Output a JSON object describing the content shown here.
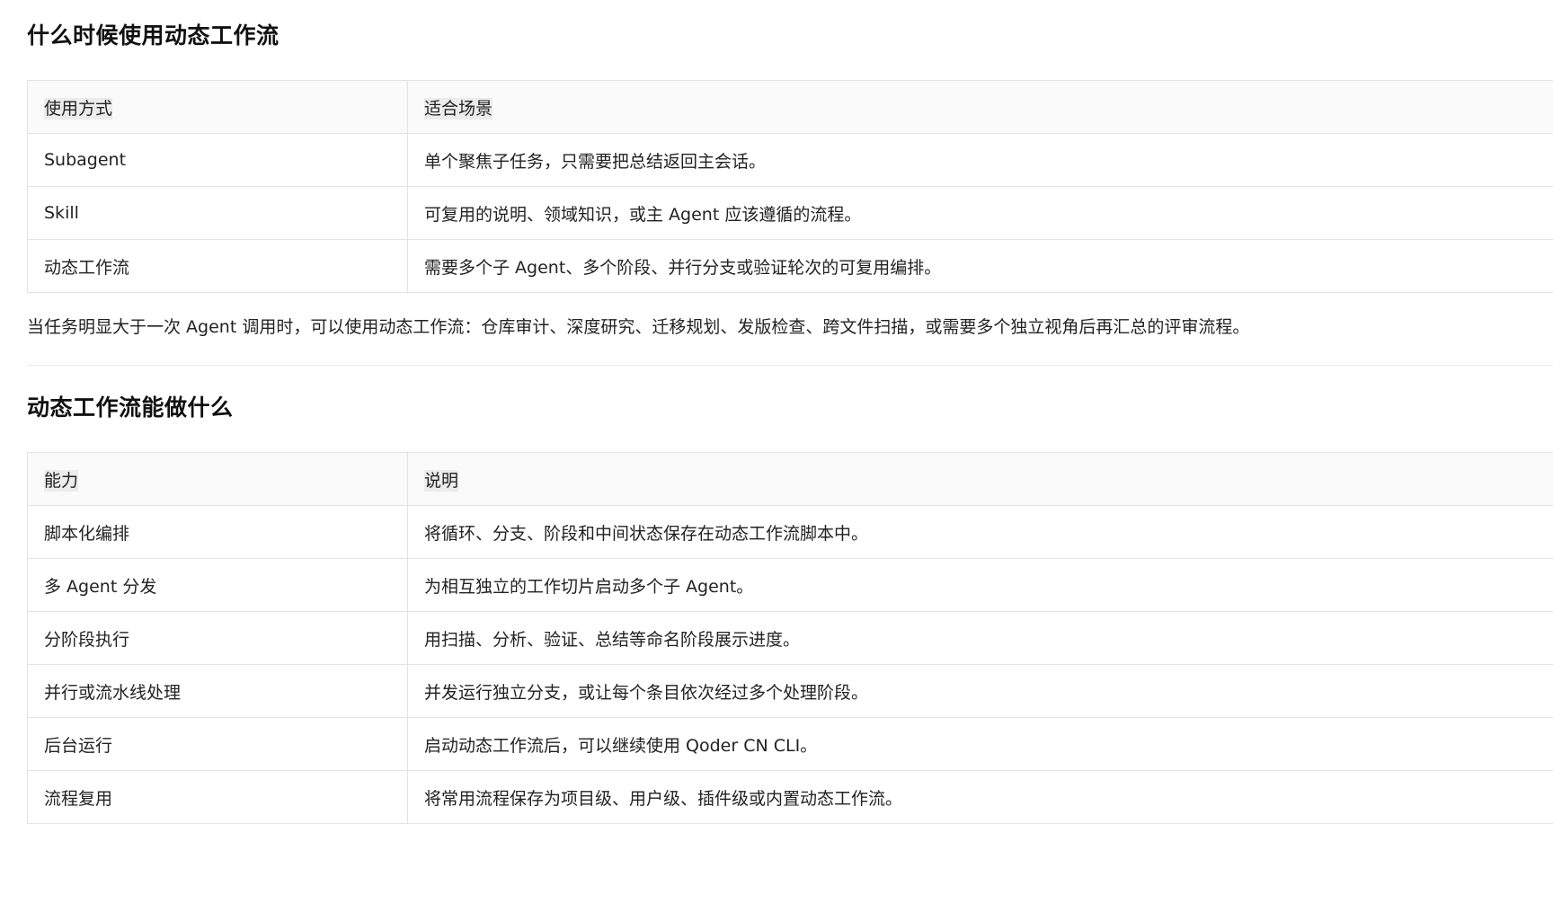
{
  "section1": {
    "title": "什么时候使用动态工作流",
    "columns": [
      "使用方式",
      "适合场景"
    ],
    "rows": [
      [
        "Subagent",
        "单个聚焦子任务，只需要把总结返回主会话。"
      ],
      [
        "Skill",
        "可复用的说明、领域知识，或主 Agent 应该遵循的流程。"
      ],
      [
        "动态工作流",
        "需要多个子 Agent、多个阶段、并行分支或验证轮次的可复用编排。"
      ]
    ],
    "paragraph": "当任务明显大于一次 Agent 调用时，可以使用动态工作流：仓库审计、深度研究、迁移规划、发版检查、跨文件扫描，或需要多个独立视角后再汇总的评审流程。"
  },
  "section2": {
    "title": "动态工作流能做什么",
    "columns": [
      "能力",
      "说明"
    ],
    "rows": [
      [
        "脚本化编排",
        "将循环、分支、阶段和中间状态保存在动态工作流脚本中。"
      ],
      [
        "多 Agent 分发",
        "为相互独立的工作切片启动多个子 Agent。"
      ],
      [
        "分阶段执行",
        "用扫描、分析、验证、总结等命名阶段展示进度。"
      ],
      [
        "并行或流水线处理",
        "并发运行独立分支，或让每个条目依次经过多个处理阶段。"
      ],
      [
        "后台运行",
        "启动动态工作流后，可以继续使用 Qoder CN CLI。"
      ],
      [
        "流程复用",
        "将常用流程保存为项目级、用户级、插件级或内置动态工作流。"
      ]
    ]
  }
}
